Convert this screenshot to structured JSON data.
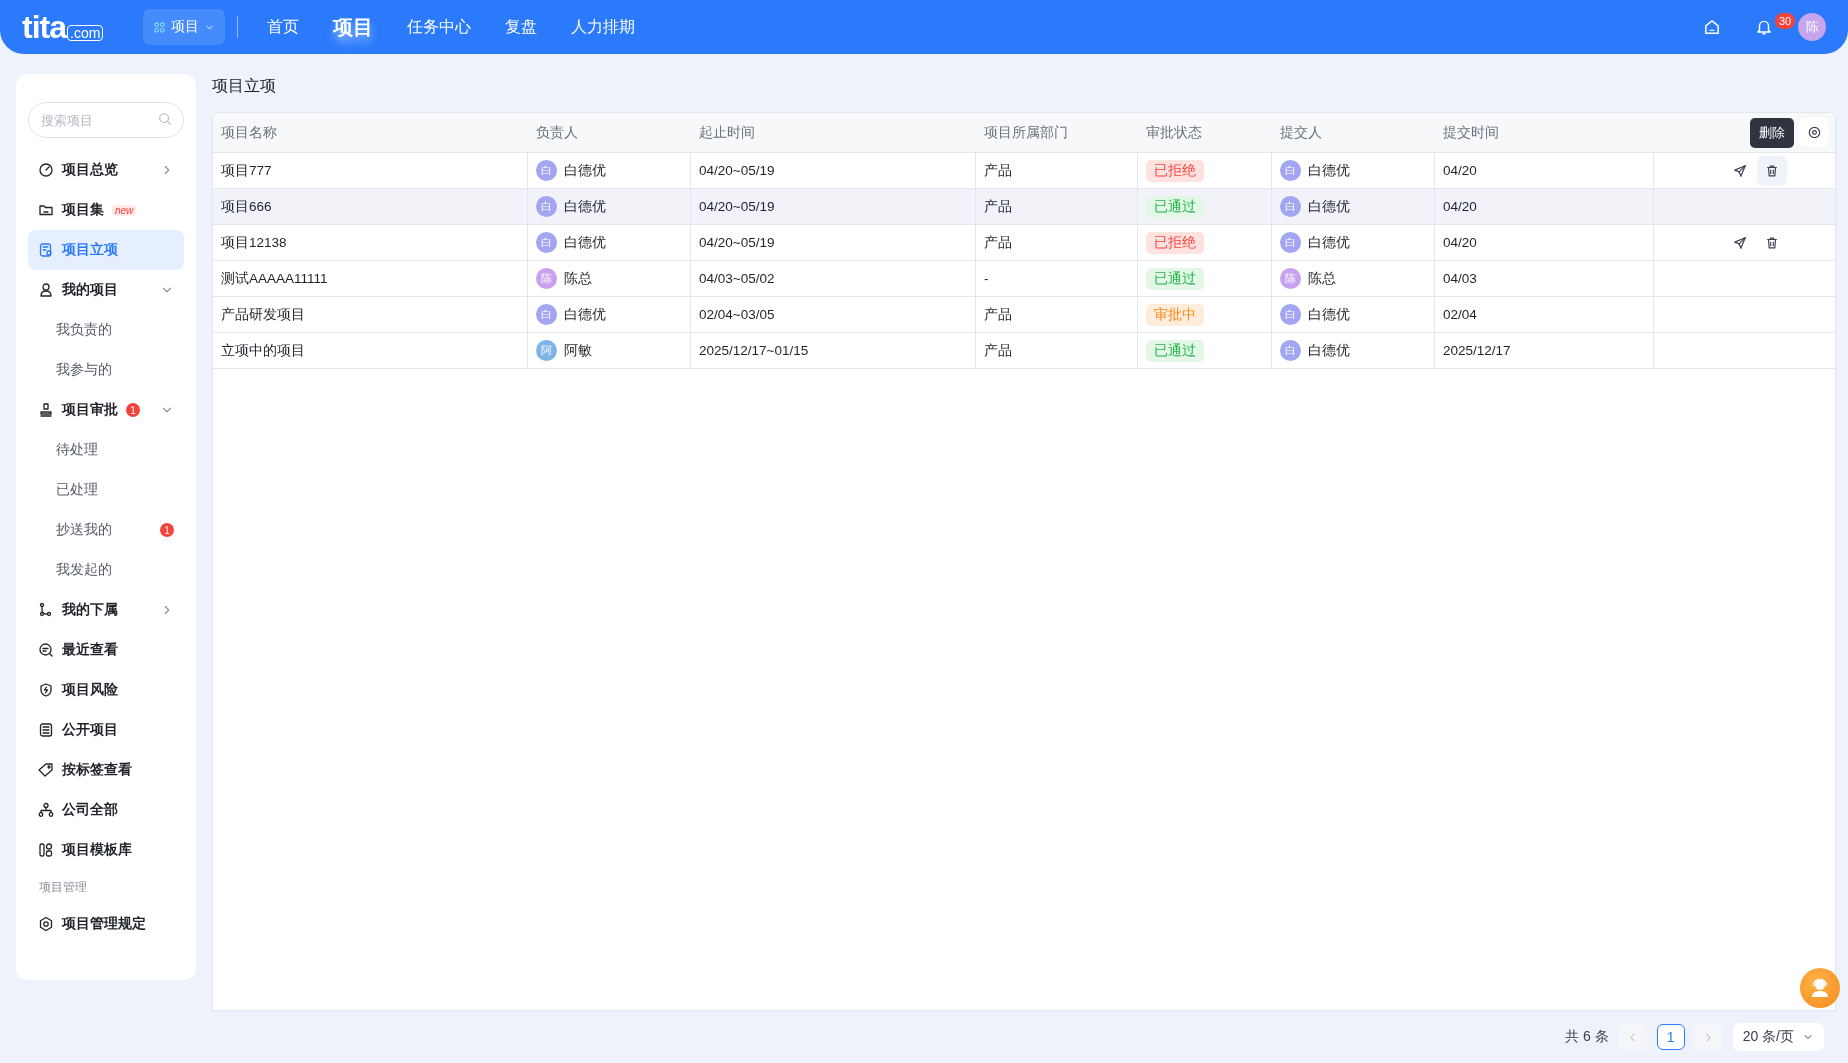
{
  "topbar": {
    "logo": {
      "text": "tita",
      "suffix": ".com"
    },
    "module_switch": {
      "label": "项目",
      "active": true
    },
    "nav": [
      {
        "label": "首页",
        "selected": false
      },
      {
        "label": "项目",
        "selected": true
      },
      {
        "label": "任务中心",
        "selected": false
      },
      {
        "label": "复盘",
        "selected": false
      },
      {
        "label": "人力排期",
        "selected": false
      }
    ],
    "notifications": "30",
    "avatar": "陈"
  },
  "sidebar": {
    "search": {
      "placeholder": "搜索项目"
    },
    "items": [
      {
        "kind": "nav",
        "label": "项目总览",
        "selected": false,
        "expanded": false
      },
      {
        "kind": "nav",
        "label": "项目集",
        "selected": false,
        "tag": "new"
      },
      {
        "kind": "nav",
        "label": "项目立项",
        "selected": true
      },
      {
        "kind": "nav",
        "label": "我的项目",
        "selected": false,
        "expanded": true
      },
      {
        "kind": "sub",
        "label": "我负责的",
        "selected": false
      },
      {
        "kind": "sub",
        "label": "我参与的",
        "selected": false
      },
      {
        "kind": "nav",
        "label": "项目审批",
        "selected": false,
        "badge": "1",
        "expanded": true
      },
      {
        "kind": "sub",
        "label": "待处理",
        "selected": false
      },
      {
        "kind": "sub",
        "label": "已处理",
        "selected": false
      },
      {
        "kind": "sub",
        "label": "抄送我的",
        "selected": false,
        "badge": "1"
      },
      {
        "kind": "sub",
        "label": "我发起的",
        "selected": false
      },
      {
        "kind": "nav",
        "label": "我的下属",
        "selected": false,
        "expanded": false
      },
      {
        "kind": "nav",
        "label": "最近查看",
        "selected": false
      },
      {
        "kind": "nav",
        "label": "项目风险",
        "selected": false
      },
      {
        "kind": "nav",
        "label": "公开项目",
        "selected": false
      },
      {
        "kind": "nav",
        "label": "按标签查看",
        "selected": false
      },
      {
        "kind": "nav",
        "label": "公司全部",
        "selected": false
      },
      {
        "kind": "nav",
        "label": "项目模板库",
        "selected": false
      },
      {
        "kind": "section",
        "label": "项目管理"
      },
      {
        "kind": "nav",
        "label": "项目管理规定",
        "selected": false
      }
    ]
  },
  "page_title": "项目立项",
  "table": {
    "columns": [
      "项目名称",
      "负责人",
      "起止时间",
      "项目所属部门",
      "审批状态",
      "提交人",
      "提交时间"
    ],
    "tooltip": "删除",
    "rows": [
      {
        "name": "项目777",
        "owner": {
          "initial": "白",
          "name": "白德优",
          "color": "#a2a5ef"
        },
        "period": "04/20~05/19",
        "department": "产品",
        "status": {
          "text": "已拒绝",
          "kind": "rejected"
        },
        "submitter": {
          "initial": "白",
          "name": "白德优",
          "color": "#a2a5ef"
        },
        "submitted": "04/20",
        "actions": true,
        "highlighted": false
      },
      {
        "name": "项目666",
        "owner": {
          "initial": "白",
          "name": "白德优",
          "color": "#a2a5ef"
        },
        "period": "04/20~05/19",
        "department": "产品",
        "status": {
          "text": "已通过",
          "kind": "approved"
        },
        "submitter": {
          "initial": "白",
          "name": "白德优",
          "color": "#a2a5ef"
        },
        "submitted": "04/20",
        "actions": false,
        "highlighted": true
      },
      {
        "name": "项目12138",
        "owner": {
          "initial": "白",
          "name": "白德优",
          "color": "#a2a5ef"
        },
        "period": "04/20~05/19",
        "department": "产品",
        "status": {
          "text": "已拒绝",
          "kind": "rejected"
        },
        "submitter": {
          "initial": "白",
          "name": "白德优",
          "color": "#a2a5ef"
        },
        "submitted": "04/20",
        "actions": true,
        "highlighted": false
      },
      {
        "name": "测试AAAAA11111",
        "owner": {
          "initial": "陈",
          "name": "陈总",
          "color": "#c9a2ef"
        },
        "period": "04/03~05/02",
        "department": "-",
        "status": {
          "text": "已通过",
          "kind": "approved"
        },
        "submitter": {
          "initial": "陈",
          "name": "陈总",
          "color": "#c9a2ef"
        },
        "submitted": "04/03",
        "actions": false,
        "highlighted": false
      },
      {
        "name": "产品研发项目",
        "owner": {
          "initial": "白",
          "name": "白德优",
          "color": "#a2a5ef"
        },
        "period": "02/04~03/05",
        "department": "产品",
        "status": {
          "text": "审批中",
          "kind": "pending"
        },
        "submitter": {
          "initial": "白",
          "name": "白德优",
          "color": "#a2a5ef"
        },
        "submitted": "02/04",
        "actions": false,
        "highlighted": false
      },
      {
        "name": "立项中的项目",
        "owner": {
          "initial": "阿",
          "name": "阿敏",
          "color": "#7fb4e6"
        },
        "period": "2025/12/17~01/15",
        "department": "产品",
        "status": {
          "text": "已通过",
          "kind": "approved"
        },
        "submitter": {
          "initial": "白",
          "name": "白德优",
          "color": "#a2a5ef"
        },
        "submitted": "2025/12/17",
        "actions": false,
        "highlighted": false
      }
    ]
  },
  "pagination": {
    "total": "共 6 条",
    "pages": [
      {
        "label": "1",
        "selected": true
      }
    ],
    "page_size": "20 条/页"
  }
}
